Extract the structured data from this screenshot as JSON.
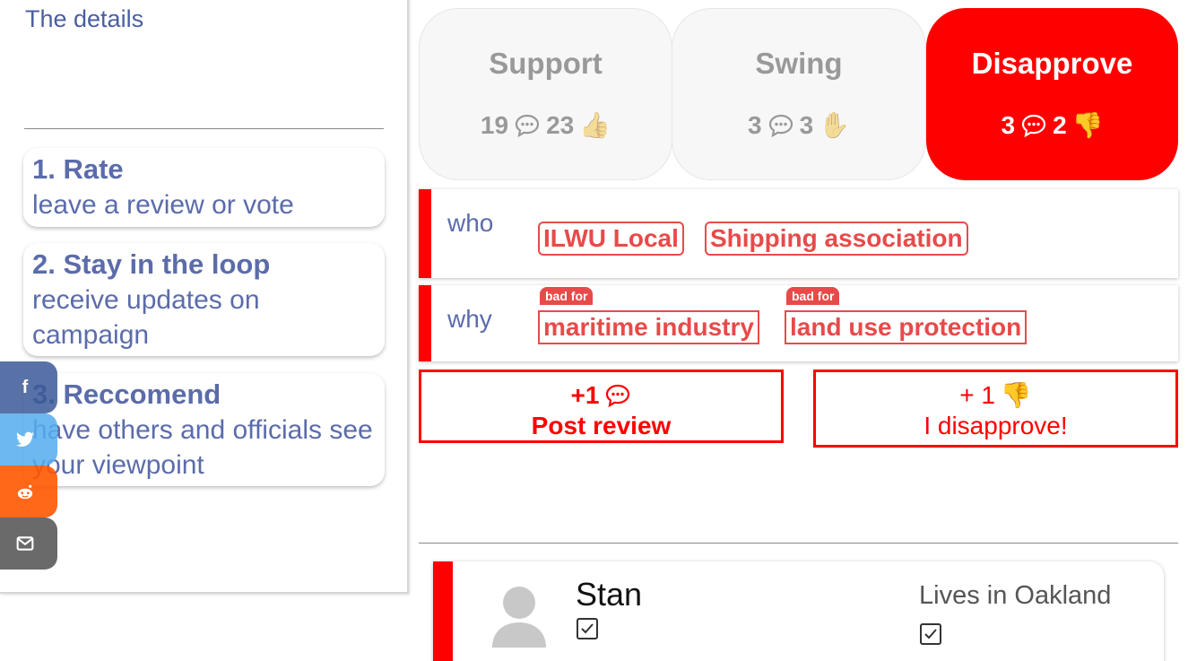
{
  "left_panel": {
    "title": "The details",
    "steps": [
      {
        "title": "1. Rate",
        "desc": "leave a review or vote"
      },
      {
        "title": "2. Stay in the loop",
        "desc": "receive updates on campaign"
      },
      {
        "title": "3. Reccomend",
        "desc": "have others and officials see your viewpoint"
      }
    ]
  },
  "share": {
    "facebook": "f",
    "twitter_icon": "twitter-icon",
    "reddit_icon": "reddit-icon",
    "email_icon": "email-icon"
  },
  "votes": [
    {
      "label": "Support",
      "comments": "19",
      "count": "23",
      "icon": "thumbs-up"
    },
    {
      "label": "Swing",
      "comments": "3",
      "count": "3",
      "icon": "raised-hand"
    },
    {
      "label": "Disapprove",
      "comments": "3",
      "count": "2",
      "icon": "thumbs-down"
    }
  ],
  "who": {
    "label": "who",
    "tags": [
      "ILWU Local",
      "Shipping association"
    ]
  },
  "why": {
    "label": "why",
    "tags": [
      {
        "badge": "bad for",
        "text": "maritime industry"
      },
      {
        "badge": "bad for",
        "text": "land use protection"
      }
    ]
  },
  "actions": {
    "post_review": {
      "count": "+1",
      "label": "Post review"
    },
    "disapprove": {
      "count": "+ 1",
      "label": "I disapprove!"
    }
  },
  "review": {
    "name": "Stan",
    "location": "Lives in Oakland"
  },
  "colors": {
    "accent": "#ff0000",
    "tag": "#e84a4a",
    "text_blue": "#5b6cab"
  }
}
